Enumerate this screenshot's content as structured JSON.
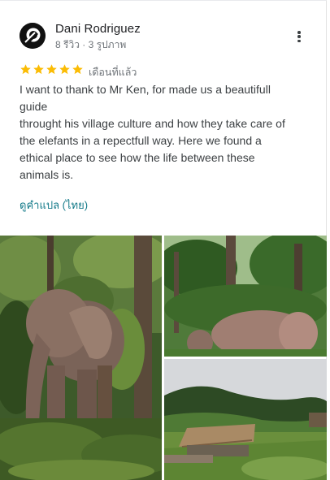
{
  "reviewer": {
    "name": "Dani Rodriguez",
    "meta": "8 รีวิว · 3 รูปภาพ"
  },
  "rating": {
    "stars": 5,
    "max": 5,
    "when": "เดือนที่แล้ว"
  },
  "review": {
    "lines": [
      "I want to thank to Mr Ken, for made us a beautifull",
      "guide",
      "throught his village culture and how they take care of",
      "the elefants in a repectfull way. Here we found a",
      "ethical place to see how the life between these",
      "animals is."
    ]
  },
  "translate_label": "ดูคำแปล (ไทย)",
  "photos": [
    {
      "icon": "elephant-forest-photo"
    },
    {
      "icon": "elephants-trees-photo"
    },
    {
      "icon": "hut-landscape-photo"
    }
  ],
  "colors": {
    "star": "#fbbc04",
    "link": "#137a89"
  }
}
